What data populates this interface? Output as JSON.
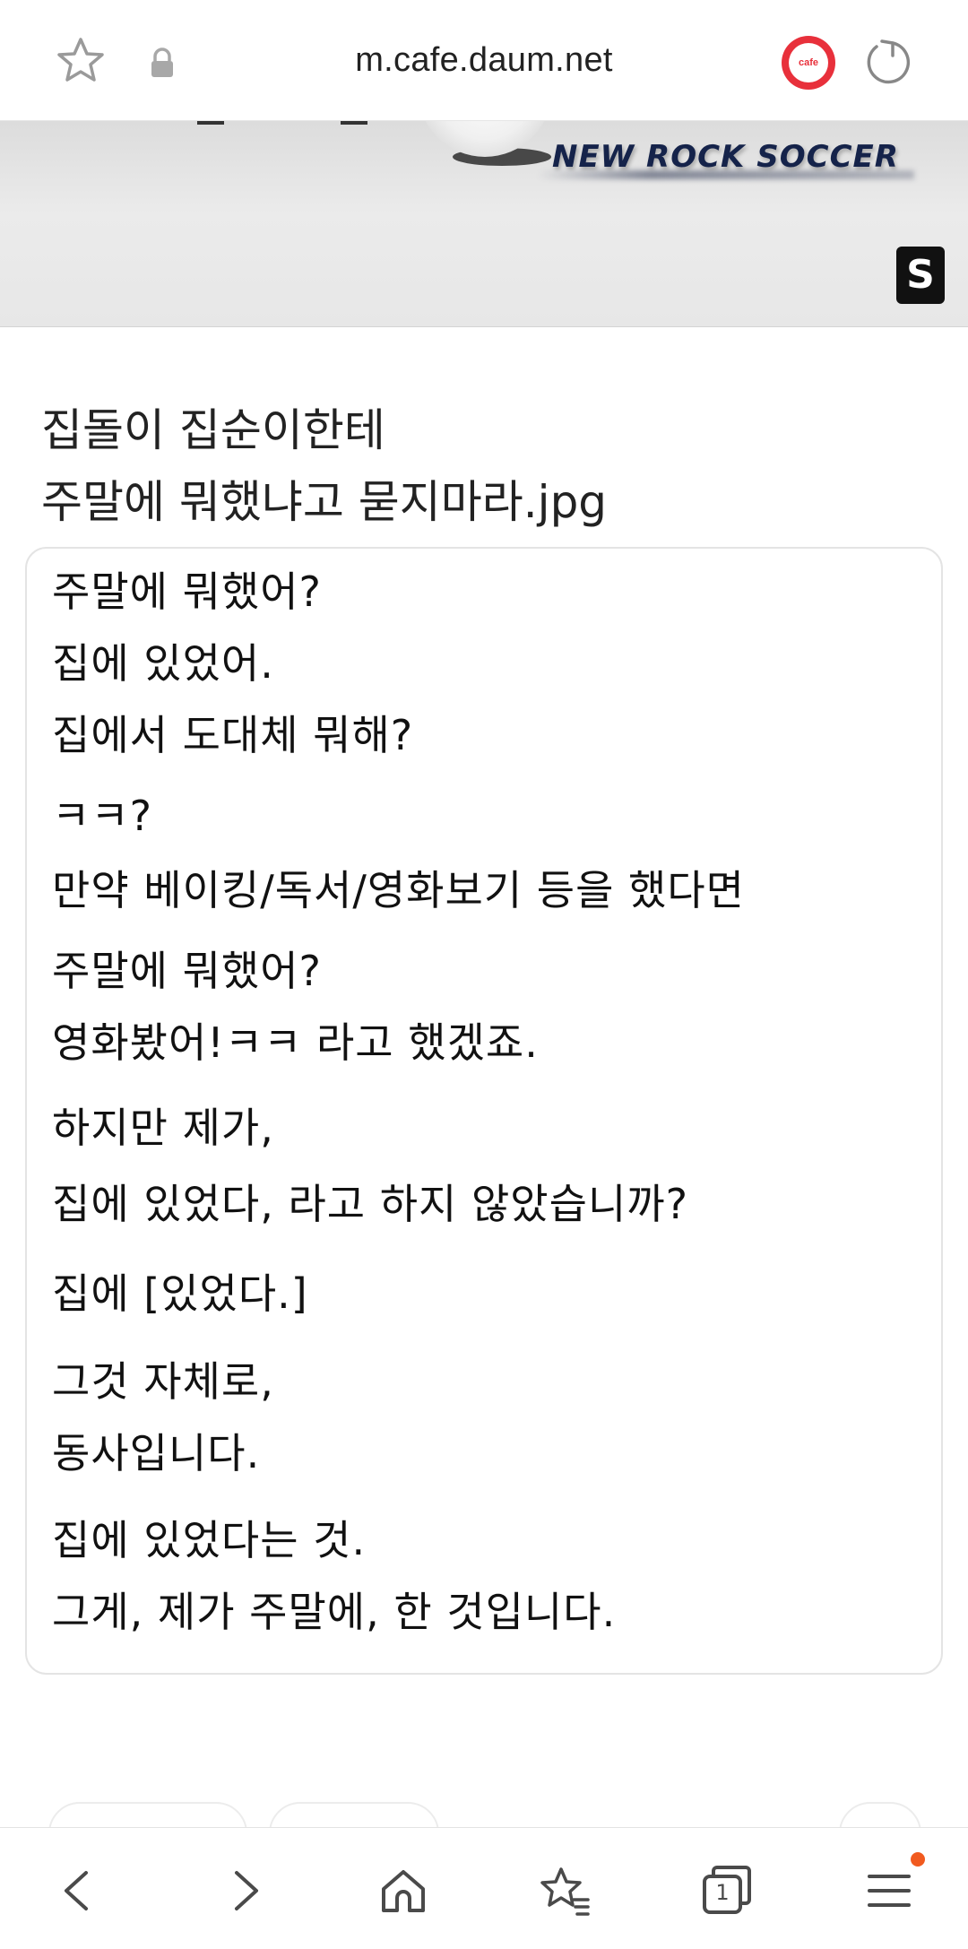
{
  "browser": {
    "url": "m.cafe.daum.net",
    "cafe_badge": "cafe"
  },
  "banner": {
    "text": "NEW ROCK SOCCER",
    "logo_letter": "S"
  },
  "post": {
    "title_lines": [
      "집돌이 집순이한테",
      "주말에 뭐했냐고 묻지마라.jpg"
    ],
    "image_lines": [
      "주말에 뭐했어?",
      "집에 있었어.",
      "집에서 도대체 뭐해?",
      "ㅋㅋ?",
      "만약 베이킹/독서/영화보기 등을 했다면",
      "주말에 뭐했어?",
      "영화봤어!ㅋㅋ 라고 했겠죠.",
      "하지만 제가,",
      "집에 있었다, 라고 하지 않았습니까?",
      "집에 [있었다.]",
      "그것 자체로,",
      "동사입니다.",
      "집에 있었다는 것.",
      "그게, 제가 주말에, 한 것입니다."
    ]
  },
  "bottom_nav": {
    "tab_count": "1",
    "icons": [
      "back-icon",
      "forward-icon",
      "home-icon",
      "bookmarks-icon",
      "tabs-icon",
      "menu-icon"
    ]
  },
  "colors": {
    "cafe_red": "#e8303b",
    "banner_navy": "#15234a",
    "notification_dot": "#f15a1f"
  }
}
